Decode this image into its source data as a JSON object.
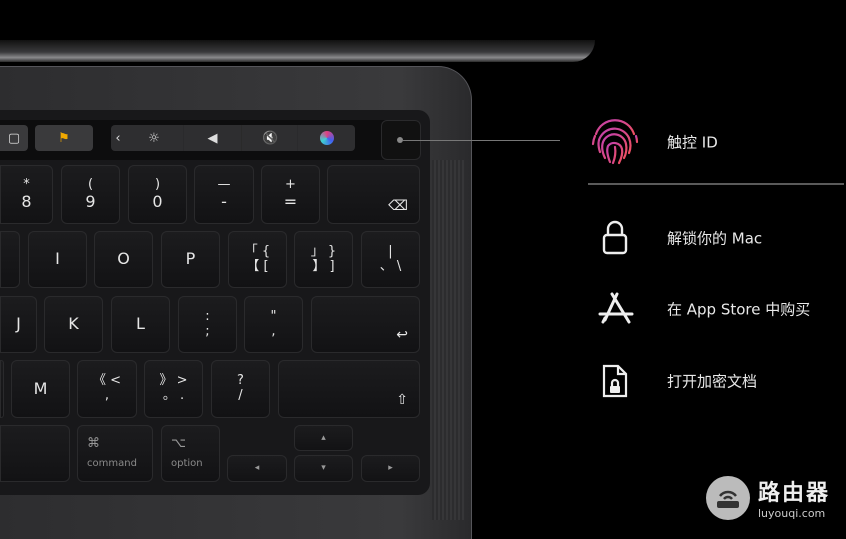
{
  "features": [
    {
      "icon": "fingerprint-icon",
      "label": "触控 ID",
      "color": "#e0407a"
    },
    {
      "icon": "lock-icon",
      "label": "解锁你的 Mac"
    },
    {
      "icon": "app-store-icon",
      "label": "在 App Store 中购买"
    },
    {
      "icon": "locked-document-icon",
      "label": "打开加密文档"
    }
  ],
  "keys": {
    "row1": [
      {
        "top": "*",
        "bottom": "8"
      },
      {
        "top": "(",
        "bottom": "9"
      },
      {
        "top": ")",
        "bottom": "0"
      },
      {
        "top": "—",
        "bottom": "-"
      },
      {
        "top": "+",
        "bottom": "="
      },
      {
        "icon": "⌫"
      }
    ],
    "row2": [
      {
        "bottom": "I"
      },
      {
        "bottom": "O"
      },
      {
        "bottom": "P"
      },
      {
        "top": "「  {",
        "bottom": "【  ["
      },
      {
        "top": "」  }",
        "bottom": "】  ]"
      },
      {
        "top": "    |",
        "bottom": "、  \\"
      }
    ],
    "row3": [
      {
        "bottom": "J"
      },
      {
        "bottom": "K"
      },
      {
        "bottom": "L"
      },
      {
        "top": ":",
        "bottom": ";"
      },
      {
        "top": "\"",
        "bottom": ","
      },
      {
        "icon": "↩"
      }
    ],
    "row4": [
      {
        "bottom": "M"
      },
      {
        "top": "《  <",
        "bottom": ",    "
      },
      {
        "top": "》  >",
        "bottom": "。  ."
      },
      {
        "top": "?",
        "bottom": "/"
      },
      {
        "icon": "⇧"
      }
    ],
    "row5": [
      {
        "top": "⌘",
        "label": "command"
      },
      {
        "top": "⌥",
        "label": "option"
      },
      {
        "arrow": "◂"
      },
      {
        "arrow": "▴"
      },
      {
        "arrow": "▾"
      },
      {
        "arrow": "▸"
      }
    ]
  },
  "touch_bar": {
    "chevron": "‹",
    "brightness": "☼",
    "volume": "◀",
    "mute": "🔇"
  },
  "watermark": {
    "title": "路由器",
    "subtitle": "luyouqi.com"
  }
}
